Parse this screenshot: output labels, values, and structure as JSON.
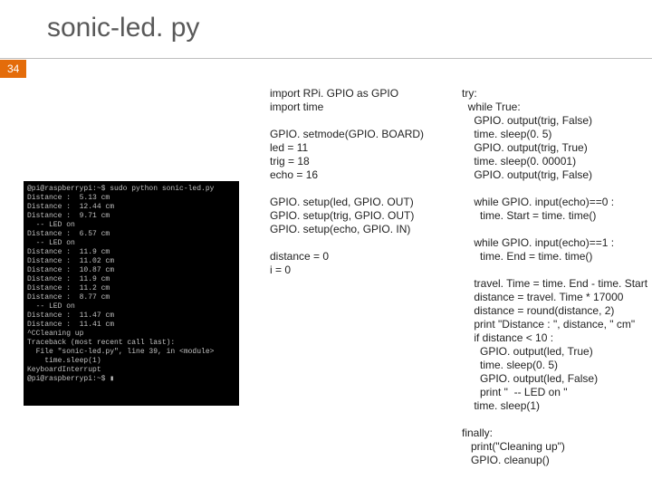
{
  "slide": {
    "title": "sonic-led. py",
    "page_number": "34"
  },
  "terminal_output": "@pi@raspberrypi:~$ sudo python sonic-led.py\nDistance :  5.13 cm\nDistance :  12.44 cm\nDistance :  9.71 cm\n  -- LED on\nDistance :  6.57 cm\n  -- LED on\nDistance :  11.9 cm\nDistance :  11.02 cm\nDistance :  10.87 cm\nDistance :  11.9 cm\nDistance :  11.2 cm\nDistance :  8.77 cm\n  -- LED on\nDistance :  11.47 cm\nDistance :  11.41 cm\n^CCleaning up\nTraceback (most recent call last):\n  File \"sonic-led.py\", line 39, in <module>\n    time.sleep(1)\nKeyboardInterrupt\n@pi@raspberrypi:~$ ▮",
  "code_left": "import RPi. GPIO as GPIO\nimport time\n\nGPIO. setmode(GPIO. BOARD)\nled = 11\ntrig = 18\necho = 16\n\nGPIO. setup(led, GPIO. OUT)\nGPIO. setup(trig, GPIO. OUT)\nGPIO. setup(echo, GPIO. IN)\n\ndistance = 0\ni = 0",
  "code_right": "try:\n  while True:\n    GPIO. output(trig, False)\n    time. sleep(0. 5)\n    GPIO. output(trig, True)\n    time. sleep(0. 00001)\n    GPIO. output(trig, False)\n\n    while GPIO. input(echo)==0 :\n      time. Start = time. time()\n\n    while GPIO. input(echo)==1 :\n      time. End = time. time()\n\n    travel. Time = time. End - time. Start\n    distance = travel. Time * 17000\n    distance = round(distance, 2)\n    print \"Distance : \", distance, \" cm\"\n    if distance < 10 :\n      GPIO. output(led, True)\n      time. sleep(0. 5)\n      GPIO. output(led, False)\n      print \"  -- LED on \"\n    time. sleep(1)\n\nfinally:\n   print(\"Cleaning up\")\n   GPIO. cleanup()"
}
